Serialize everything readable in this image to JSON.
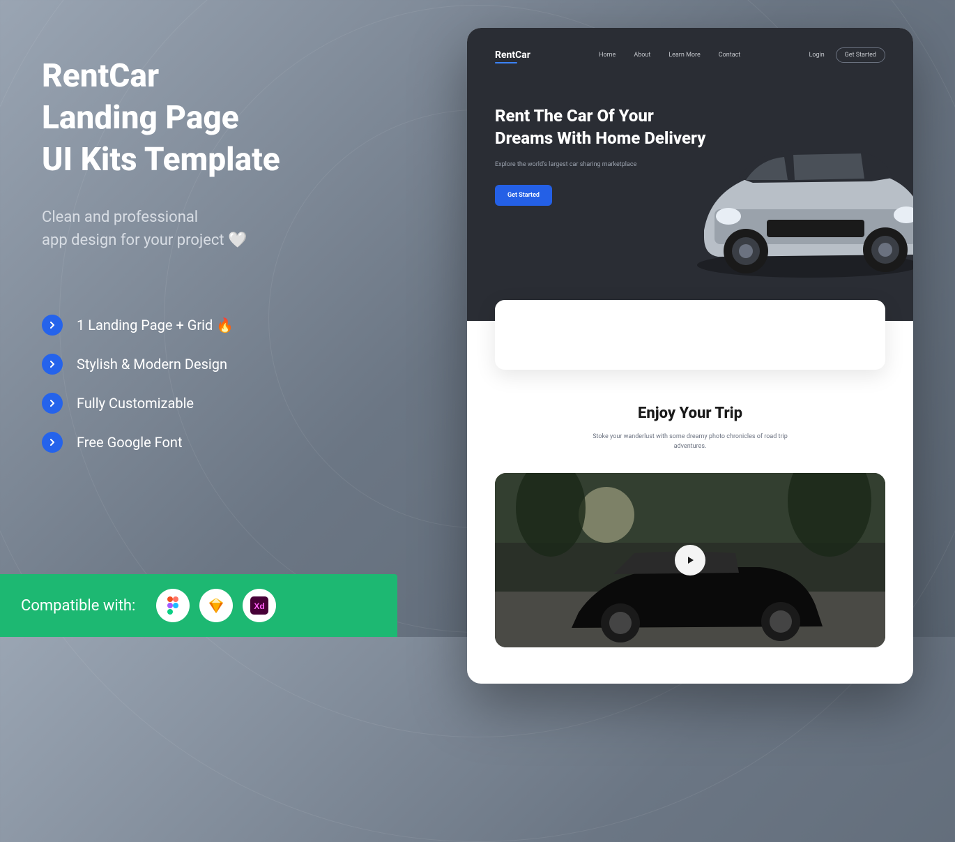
{
  "promo": {
    "title": "RentCar\nLanding Page\nUI Kits Template",
    "subtitle_line1": "Clean and professional",
    "subtitle_line2": "app design for your project",
    "features": {
      "0": "1 Landing Page + Grid 🔥",
      "1": "Stylish & Modern Design",
      "2": "Fully Customizable",
      "3": "Free Google Font"
    }
  },
  "compat": {
    "label": "Compatible with:",
    "tools": {
      "0": "Figma",
      "1": "Sketch",
      "2": "Adobe XD"
    }
  },
  "mockup": {
    "logo": "RentCar",
    "nav": {
      "0": "Home",
      "1": "About",
      "2": "Learn More",
      "3": "Contact"
    },
    "auth": {
      "login": "Login",
      "get_started": "Get Started"
    },
    "hero": {
      "title": "Rent The Car Of Your Dreams With Home Delivery",
      "subtitle": "Explore the world's largest car sharing marketplace",
      "cta": "Get Started"
    },
    "section": {
      "title": "Enjoy Your Trip",
      "subtitle": "Stoke your wanderlust with some dreamy photo chronicles of road trip adventures."
    }
  }
}
